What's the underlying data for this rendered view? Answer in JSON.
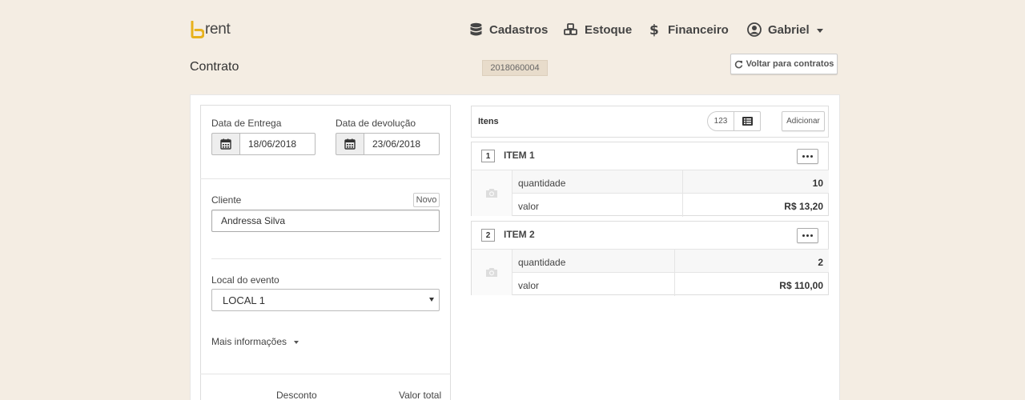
{
  "brand": {
    "logo_text": "rent",
    "accent": "#e7b11c"
  },
  "nav": {
    "items": [
      {
        "label": "Cadastros",
        "icon": "database-icon"
      },
      {
        "label": "Estoque",
        "icon": "cubes-icon"
      },
      {
        "label": "Financeiro",
        "icon": "dollar-icon"
      }
    ],
    "user": {
      "name": "Gabriel",
      "icon": "user-circle-icon"
    }
  },
  "page": {
    "title": "Contrato",
    "contract_number": "2018060004",
    "back_label": "Voltar para contratos"
  },
  "form": {
    "delivery_label": "Data de Entrega",
    "delivery_value": "18/06/2018",
    "return_label": "Data de devolução",
    "return_value": "23/06/2018",
    "client_label": "Cliente",
    "client_new_label": "Novo",
    "client_value": "Andressa Silva",
    "location_label": "Local do evento",
    "location_value": "LOCAL 1",
    "more_info_label": "Mais informações",
    "discount_label": "Desconto",
    "total_label": "Valor total"
  },
  "items_panel": {
    "title": "Itens",
    "toggle_numeric_label": "123",
    "add_label": "Adicionar",
    "items": [
      {
        "number": "1",
        "name": "ITEM 1",
        "qty_label": "quantidade",
        "qty_value": "10",
        "price_label": "valor",
        "price_value": "R$ 13,20"
      },
      {
        "number": "2",
        "name": "ITEM 2",
        "qty_label": "quantidade",
        "qty_value": "2",
        "price_label": "valor",
        "price_value": "R$ 110,00"
      }
    ]
  }
}
